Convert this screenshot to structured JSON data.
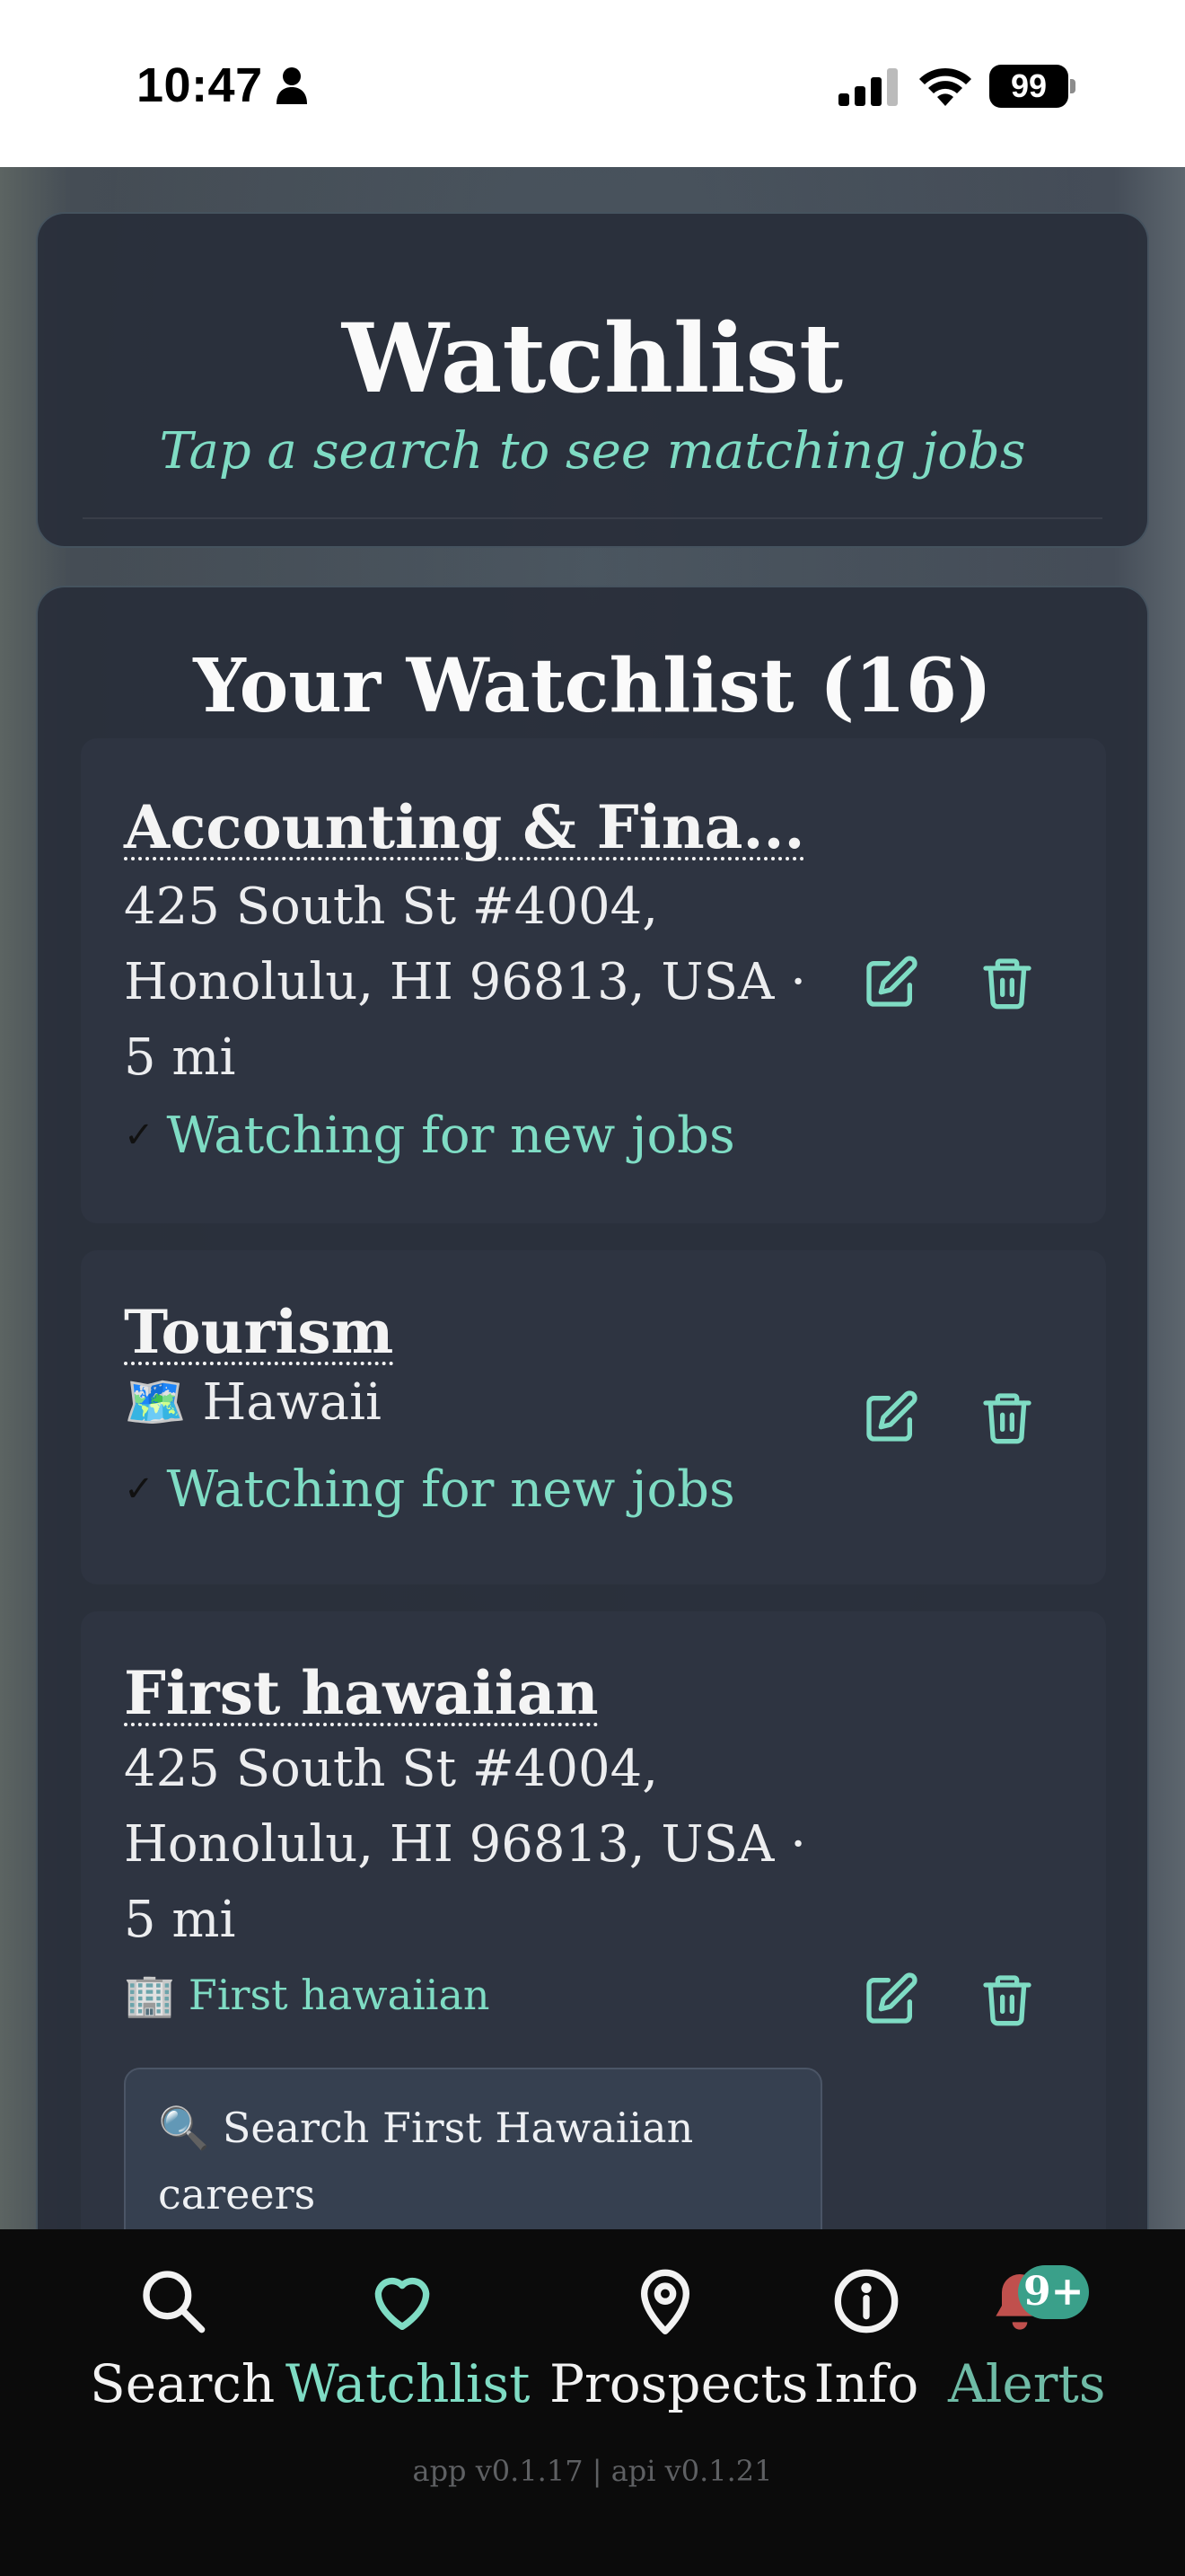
{
  "status_bar": {
    "time": "10:47",
    "battery": "99"
  },
  "header": {
    "title": "Watchlist",
    "subtitle": "Tap a search to see matching jobs"
  },
  "watchlist": {
    "title": "Your Watchlist (16)",
    "items": [
      {
        "name": "Accounting & Fina...",
        "location": "425 South St #4004, Honolulu, HI 96813, USA · 5 mi",
        "status": "Watching for new jobs"
      },
      {
        "name": "Tourism",
        "location": "🗺️ Hawaii",
        "status": "Watching for new jobs"
      },
      {
        "name": "First hawaiian",
        "location": "425 South St #4004, Honolulu, HI 96813, USA · 5 mi",
        "company": "🏢 First hawaiian",
        "careers_link": "🔍 Search First Hawaiian careers"
      }
    ]
  },
  "nav": {
    "items": [
      {
        "label": "Search",
        "icon": "search-icon"
      },
      {
        "label": "Watchlist",
        "icon": "heart-icon"
      },
      {
        "label": "Prospects",
        "icon": "map-pin-icon"
      },
      {
        "label": "Info",
        "icon": "info-icon"
      },
      {
        "label": "Alerts",
        "icon": "bell-icon",
        "badge": "9+"
      }
    ],
    "version": "app v0.1.17 | api v0.1.21"
  },
  "colors": {
    "accent": "#7fdcc4",
    "panel": "#2a303c",
    "card": "#2e3441",
    "nav_background": "#0b0b0b",
    "alert_bell": "#c0504d"
  }
}
